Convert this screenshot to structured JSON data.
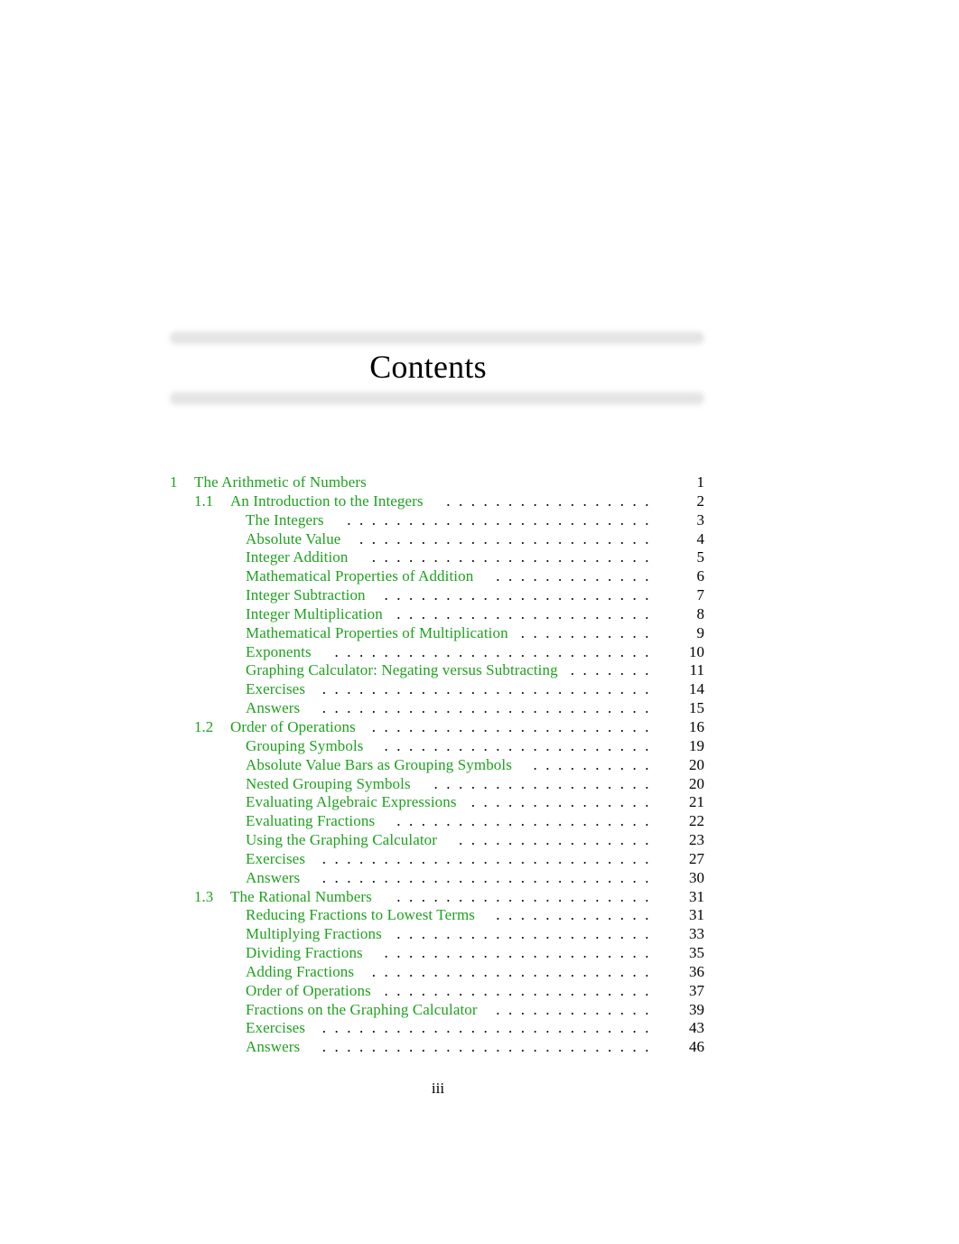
{
  "header": {
    "title": "Contents"
  },
  "toc": {
    "entries": [
      {
        "level": 0,
        "number": "1",
        "label": "The Arithmetic of Numbers",
        "page": "1",
        "dots": false
      },
      {
        "level": 1,
        "number": "1.1",
        "label": "An Introduction to the Integers",
        "page": "2",
        "dots": true
      },
      {
        "level": 2,
        "number": "",
        "label": "The Integers",
        "page": "3",
        "dots": true
      },
      {
        "level": 2,
        "number": "",
        "label": "Absolute Value",
        "page": "4",
        "dots": true
      },
      {
        "level": 2,
        "number": "",
        "label": "Integer Addition",
        "page": "5",
        "dots": true
      },
      {
        "level": 2,
        "number": "",
        "label": "Mathematical Properties of Addition",
        "page": "6",
        "dots": true
      },
      {
        "level": 2,
        "number": "",
        "label": "Integer Subtraction",
        "page": "7",
        "dots": true
      },
      {
        "level": 2,
        "number": "",
        "label": "Integer Multiplication",
        "page": "8",
        "dots": true
      },
      {
        "level": 2,
        "number": "",
        "label": "Mathematical Properties of Multiplication",
        "page": "9",
        "dots": true
      },
      {
        "level": 2,
        "number": "",
        "label": "Exponents",
        "page": "10",
        "dots": true
      },
      {
        "level": 2,
        "number": "",
        "label": "Graphing Calculator: Negating versus Subtracting",
        "page": "11",
        "dots": true
      },
      {
        "level": 2,
        "number": "",
        "label": "Exercises",
        "page": "14",
        "dots": true
      },
      {
        "level": 2,
        "number": "",
        "label": "Answers",
        "page": "15",
        "dots": true
      },
      {
        "level": 1,
        "number": "1.2",
        "label": "Order of Operations",
        "page": "16",
        "dots": true
      },
      {
        "level": 2,
        "number": "",
        "label": "Grouping Symbols",
        "page": "19",
        "dots": true
      },
      {
        "level": 2,
        "number": "",
        "label": "Absolute Value Bars as Grouping Symbols",
        "page": "20",
        "dots": true
      },
      {
        "level": 2,
        "number": "",
        "label": "Nested Grouping Symbols",
        "page": "20",
        "dots": true
      },
      {
        "level": 2,
        "number": "",
        "label": "Evaluating Algebraic Expressions",
        "page": "21",
        "dots": true
      },
      {
        "level": 2,
        "number": "",
        "label": "Evaluating Fractions",
        "page": "22",
        "dots": true
      },
      {
        "level": 2,
        "number": "",
        "label": "Using the Graphing Calculator",
        "page": "23",
        "dots": true
      },
      {
        "level": 2,
        "number": "",
        "label": "Exercises",
        "page": "27",
        "dots": true
      },
      {
        "level": 2,
        "number": "",
        "label": "Answers",
        "page": "30",
        "dots": true
      },
      {
        "level": 1,
        "number": "1.3",
        "label": "The Rational Numbers",
        "page": "31",
        "dots": true
      },
      {
        "level": 2,
        "number": "",
        "label": "Reducing Fractions to Lowest Terms",
        "page": "31",
        "dots": true
      },
      {
        "level": 2,
        "number": "",
        "label": "Multiplying Fractions",
        "page": "33",
        "dots": true
      },
      {
        "level": 2,
        "number": "",
        "label": "Dividing Fractions",
        "page": "35",
        "dots": true
      },
      {
        "level": 2,
        "number": "",
        "label": "Adding Fractions",
        "page": "36",
        "dots": true
      },
      {
        "level": 2,
        "number": "",
        "label": "Order of Operations",
        "page": "37",
        "dots": true
      },
      {
        "level": 2,
        "number": "",
        "label": "Fractions on the Graphing Calculator",
        "page": "39",
        "dots": true
      },
      {
        "level": 2,
        "number": "",
        "label": "Exercises",
        "page": "43",
        "dots": true
      },
      {
        "level": 2,
        "number": "",
        "label": "Answers",
        "page": "46",
        "dots": true
      }
    ]
  },
  "footer": {
    "folio": "iii"
  },
  "colors": {
    "link": "#1fa11f",
    "text": "#000000",
    "rule": "#e4e4e4"
  }
}
